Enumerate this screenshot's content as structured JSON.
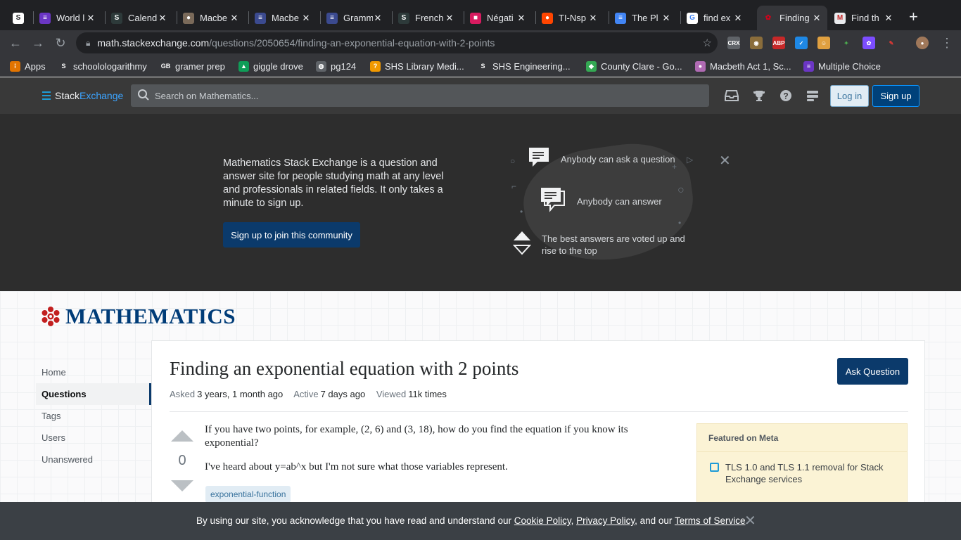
{
  "browser": {
    "tabs": [
      {
        "title": "",
        "icon": "stack-s-icon",
        "color": "#ffffff",
        "fg": "#202124",
        "glyph": "S"
      },
      {
        "title": "World l",
        "icon": "list-app-icon",
        "color": "#6b36c4",
        "glyph": "≡"
      },
      {
        "title": "Calend",
        "icon": "stack-s-icon",
        "color": "#2d3a3a",
        "glyph": "S"
      },
      {
        "title": "Macbe",
        "icon": "avatar-icon",
        "color": "#7a6a5a",
        "glyph": "●"
      },
      {
        "title": "Macbe",
        "icon": "doc-icon",
        "color": "#3b4a8f",
        "glyph": "≡"
      },
      {
        "title": "Gramm",
        "icon": "doc-icon",
        "color": "#3b4a8f",
        "glyph": "≡"
      },
      {
        "title": "French",
        "icon": "stack-s-icon",
        "color": "#2d3a3a",
        "glyph": "S"
      },
      {
        "title": "Négati",
        "icon": "grid-color-icon",
        "color": "#d81b60",
        "glyph": "■"
      },
      {
        "title": "TI-Nsp",
        "icon": "reddit-icon",
        "color": "#ff4500",
        "glyph": "●"
      },
      {
        "title": "The Pl",
        "icon": "docs-icon",
        "color": "#4285f4",
        "glyph": "≡"
      },
      {
        "title": "find ex",
        "icon": "google-icon",
        "color": "#ffffff",
        "fg": "#4285f4",
        "glyph": "G"
      },
      {
        "title": "Finding",
        "icon": "math-se-icon",
        "color": "#35363a",
        "fg": "#d0021b",
        "glyph": "✿",
        "active": true
      },
      {
        "title": "Find th",
        "icon": "m-logo-icon",
        "color": "#e8eaed",
        "fg": "#c62828",
        "glyph": "M"
      }
    ],
    "url_host": "math.stackexchange.com",
    "url_path": "/questions/2050654/finding-an-exponential-equation-with-2-points",
    "bookmarks": [
      {
        "label": "Apps",
        "icon": "apps-grid-icon",
        "color": "#e37400",
        "glyph": "⁞"
      },
      {
        "label": "schoolologarithmy",
        "icon": "stack-s-icon",
        "color": "#35363a",
        "glyph": "S"
      },
      {
        "label": "gramer prep",
        "icon": "gb-icon",
        "color": "#35363a",
        "glyph": "GB"
      },
      {
        "label": "giggle drove",
        "icon": "drive-icon",
        "color": "#0f9d58",
        "glyph": "▲"
      },
      {
        "label": "pg124",
        "icon": "globe-icon",
        "color": "#5f6368",
        "glyph": "◍"
      },
      {
        "label": "SHS Library Medi...",
        "icon": "library-icon",
        "color": "#f29900",
        "glyph": "?"
      },
      {
        "label": "SHS Engineering...",
        "icon": "stack-s-icon",
        "color": "#35363a",
        "glyph": "S"
      },
      {
        "label": "County Clare - Go...",
        "icon": "maps-icon",
        "color": "#34a853",
        "glyph": "◆"
      },
      {
        "label": "Macbeth Act 1, Sc...",
        "icon": "avatar-icon",
        "color": "#b06ab3",
        "glyph": "●"
      },
      {
        "label": "Multiple Choice",
        "icon": "list-app-icon",
        "color": "#6b36c4",
        "glyph": "≡"
      }
    ]
  },
  "site": {
    "logo_stack": "Stack",
    "logo_exchange": "Exchange",
    "search_placeholder": "Search on Mathematics...",
    "login": "Log in",
    "signup": "Sign up"
  },
  "hero": {
    "text": "Mathematics Stack Exchange is a question and answer site for people studying math at any level and professionals in related fields. It only takes a minute to sign up.",
    "button": "Sign up to join this community",
    "items": [
      "Anybody can ask a question",
      "Anybody can answer",
      "The best answers are voted up and rise to the top"
    ]
  },
  "content": {
    "site_name": "MATHEMATICS",
    "nav": [
      "Home",
      "Questions",
      "Tags",
      "Users",
      "Unanswered"
    ],
    "question": {
      "title": "Finding an exponential equation with 2 points",
      "asked_label": "Asked",
      "asked": "3 years, 1 month ago",
      "active_label": "Active",
      "active": "7 days ago",
      "viewed_label": "Viewed",
      "viewed": "11k times",
      "votes": "0",
      "body1": "If you have two points, for example, (2, 6) and (3, 18), how do you find the equation if you know its exponential?",
      "body2": "I've heard about y=ab^x but I'm not sure what those variables represent.",
      "tag": "exponential-function"
    },
    "ask_button": "Ask Question",
    "meta_heading": "Featured on Meta",
    "meta_item": "TLS 1.0 and TLS 1.1 removal for Stack Exchange services"
  },
  "cookie": {
    "pre": "By using our site, you acknowledge that you have read and understand our ",
    "cookie_policy": "Cookie Policy",
    "sep1": ", ",
    "privacy_policy": "Privacy Policy",
    "sep2": ", and our ",
    "terms": "Terms of Service",
    "post": "."
  }
}
